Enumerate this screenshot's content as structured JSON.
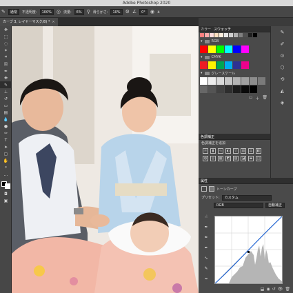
{
  "window": {
    "title": "Adobe Photoshop 2020"
  },
  "options_bar": {
    "mode_label": "通常",
    "opacity_label": "不透明度:",
    "opacity_value": "100%",
    "flow_label": "流量:",
    "flow_value": "6%",
    "smooth_label": "滑らかさ:",
    "smooth_value": "10%",
    "angle_value": "0°"
  },
  "document_tab": {
    "label": "カーブ 3, レイヤーマスク/8) *",
    "close": "×"
  },
  "swatches_panel": {
    "tabs": [
      "カラー",
      "スウォッチ"
    ],
    "groups": [
      {
        "name": "RGB",
        "colors": [
          "#ff0000",
          "#ffff00",
          "#00ff00",
          "#00ffff",
          "#0000ff",
          "#ff00ff"
        ]
      },
      {
        "name": "CMYK",
        "colors": [
          "#ed1c24",
          "#fff200",
          "#00a651",
          "#00aeef",
          "#2e3192",
          "#ec008c"
        ]
      },
      {
        "name": "グレースケール",
        "colors": [
          "#ffffff",
          "#ececec",
          "#d9d9d9",
          "#c6c6c6",
          "#b3b3b3",
          "#a0a0a0",
          "#8d8d8d",
          "#7a7a7a",
          "#676767",
          "#545454",
          "#414141",
          "#2e2e2e",
          "#1b1b1b",
          "#0a0a0a",
          "#000000"
        ]
      }
    ],
    "top_colors": [
      "#ff8080",
      "#ffaaaa",
      "#ffdddd",
      "#ffe0c0",
      "#fff0e0",
      "#e8e8e8",
      "#cfcfcf",
      "#b0b0b0",
      "#808080",
      "#505050",
      "#202020",
      "#000000"
    ]
  },
  "adjustments_panel": {
    "tab": "色調補正",
    "subtitle": "色調補正を追加"
  },
  "properties_panel": {
    "tab": "属性",
    "type_label": "トーンカーブ",
    "preset_label": "プリセット:",
    "preset_value": "カスタム",
    "channel_value": "RGB",
    "auto_button": "自動補正"
  },
  "colors": {
    "ui_dark": "#3b3b3b",
    "panel": "#4a4a4a",
    "curve": "#2b6cd6"
  }
}
